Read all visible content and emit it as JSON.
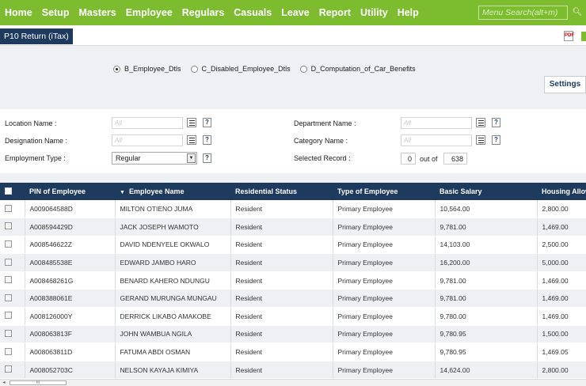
{
  "nav": {
    "items": [
      "Home",
      "Setup",
      "Masters",
      "Employee",
      "Regulars",
      "Casuals",
      "Leave",
      "Report",
      "Utility",
      "Help"
    ],
    "search_placeholder": "Menu Search(alt+m)",
    "search_icon": "search-icon"
  },
  "title": {
    "tab_label": "P10 Return (iTax)",
    "pdf_icon": "pdf-icon"
  },
  "radios": {
    "options": [
      "B_Employee_Dtls",
      "C_Disabled_Employee_Dtls",
      "D_Computation_of_Car_Benefits"
    ],
    "selected": "B_Employee_Dtls"
  },
  "settings_label": "Settings",
  "filters": {
    "location_label": "Location Name :",
    "location_value": "All",
    "designation_label": "Designation Name :",
    "designation_value": "All",
    "employment_label": "Employment Type :",
    "employment_value": "Regular",
    "department_label": "Department Name :",
    "department_value": "All",
    "category_label": "Category Name :",
    "category_value": "All",
    "selected_label": "Selected Record :",
    "selected_count": "0",
    "out_of_label": "out of",
    "total_count": "638",
    "help_glyph": "?"
  },
  "table": {
    "columns": [
      "PIN of Employee",
      "Employee Name",
      "Residential Status",
      "Type of Employee",
      "Basic Salary",
      "Housing Allowance"
    ],
    "rows": [
      [
        "A009064588D",
        "MILTON OTIENO JUMA",
        "Resident",
        "Primary Employee",
        "10,564.00",
        "2,800.00"
      ],
      [
        "A008594429D",
        "JACK JOSEPH WAMOTO",
        "Resident",
        "Primary Employee",
        "9,781.00",
        "1,469.00"
      ],
      [
        "A008546622Z",
        "DAVID NDENYELE OKWALO",
        "Resident",
        "Primary Employee",
        "14,103.00",
        "2,500.00"
      ],
      [
        "A008485538E",
        "EDWARD JAMBO HARO",
        "Resident",
        "Primary Employee",
        "16,200.00",
        "5,000.00"
      ],
      [
        "A008468261G",
        "BENARD KAHERO NDUNGU",
        "Resident",
        "Primary Employee",
        "9,781.00",
        "1,469.00"
      ],
      [
        "A008388061E",
        "GERAND MURUNGA MUNGAU",
        "Resident",
        "Primary Employee",
        "9,781.00",
        "1,469.00"
      ],
      [
        "A008126000Y",
        "DERRICK LIKABO AMAKOBE",
        "Resident",
        "Primary Employee",
        "9,780.00",
        "1,469.00"
      ],
      [
        "A008063813F",
        "JOHN WAMBUA NGILA",
        "Resident",
        "Primary Employee",
        "9,780.95",
        "1,500.00"
      ],
      [
        "A008063811D",
        "FATUMA ABDI OSMAN",
        "Resident",
        "Primary Employee",
        "9,780.95",
        "1,469.05"
      ],
      [
        "A008052703C",
        "NELSON KAYAJA KIMIYA",
        "Resident",
        "Primary Employee",
        "14,624.00",
        "2,800.00"
      ]
    ]
  },
  "scrollbar": {
    "thumb_glyph": "III",
    "left_arrow": "◂"
  },
  "colors": {
    "nav_green": "#7dbb2f",
    "header_navy": "#1f3a5f"
  }
}
